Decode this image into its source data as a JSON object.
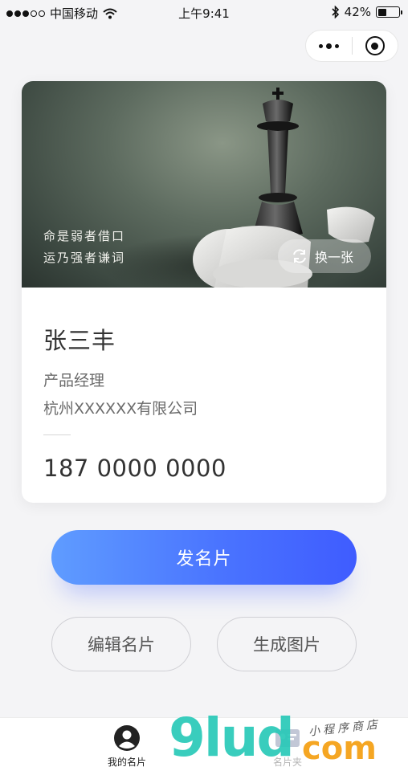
{
  "status_bar": {
    "carrier": "中国移动",
    "time": "上午9:41",
    "battery": "42%",
    "battery_level": 0.42,
    "signal_bars_filled": 3,
    "signal_bars_total": 5
  },
  "capsule": {
    "more_icon": "ellipsis-icon",
    "close_icon": "target-close-icon"
  },
  "card": {
    "cover": {
      "quote_line1": "命是弱者借口",
      "quote_line2": "运乃强者谦词",
      "swap_label": "换一张",
      "swap_icon": "refresh-icon"
    },
    "name": "张三丰",
    "title": "产品经理",
    "company": "杭州XXXXXX有限公司",
    "phone": "187 0000 0000"
  },
  "actions": {
    "send_label": "发名片",
    "edit_label": "编辑名片",
    "generate_label": "生成图片"
  },
  "tabbar": {
    "tabs": [
      {
        "label": "我的名片",
        "icon": "user-icon",
        "active": true
      },
      {
        "label": "名片夹",
        "icon": "card-folder-icon",
        "active": false
      }
    ]
  },
  "watermark": {
    "brand": "9lud",
    "domain": "com",
    "tagline": "小程序商店"
  },
  "colors": {
    "accent_start": "#5f9cff",
    "accent_end": "#3f5cff",
    "background": "#f4f4f6"
  }
}
